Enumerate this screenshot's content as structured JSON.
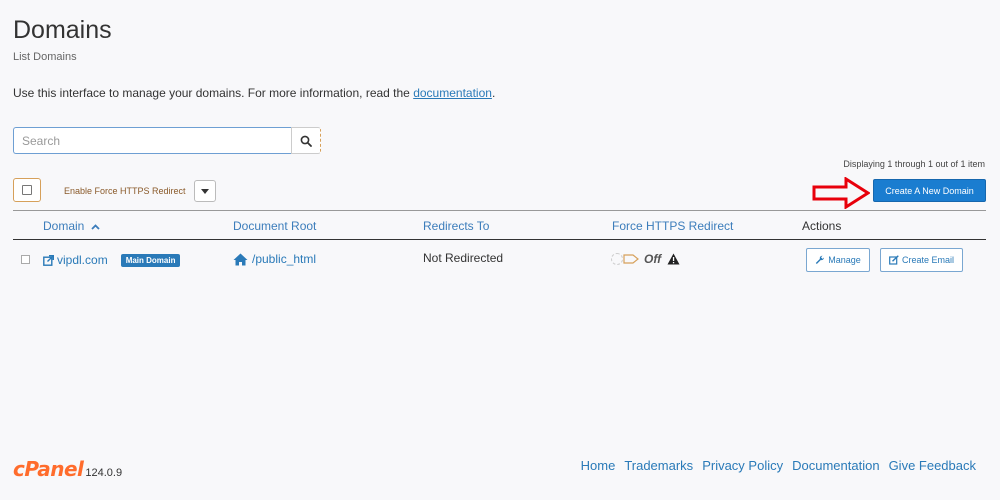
{
  "header": {
    "title": "Domains",
    "subtitle": "List Domains",
    "intro_text": "Use this interface to manage your domains. For more information, read the ",
    "intro_link": "documentation",
    "intro_end": "."
  },
  "search": {
    "placeholder": "Search",
    "value": ""
  },
  "toolbar": {
    "display_count": "Displaying 1 through 1 out of 1 item",
    "force_https_label": "Enable Force HTTPS Redirect",
    "create_domain_label": "Create A New Domain"
  },
  "table": {
    "headers": {
      "domain": "Domain",
      "document_root": "Document Root",
      "redirects_to": "Redirects To",
      "force_https": "Force HTTPS Redirect",
      "actions": "Actions"
    },
    "rows": [
      {
        "domain": "vipdl.com",
        "badge": "Main Domain",
        "document_root": "/public_html",
        "redirects_to": "Not Redirected",
        "https_state": "Off",
        "manage_label": "Manage",
        "create_email_label": "Create Email"
      }
    ]
  },
  "footer": {
    "logo": "cPanel",
    "version": "124.0.9",
    "links": [
      "Home",
      "Trademarks",
      "Privacy Policy",
      "Documentation",
      "Give Feedback"
    ]
  },
  "colors": {
    "primary": "#1a7dd0",
    "link": "#2a7ab8",
    "logo": "#ff6c2c",
    "arrow": "#e8000b"
  }
}
